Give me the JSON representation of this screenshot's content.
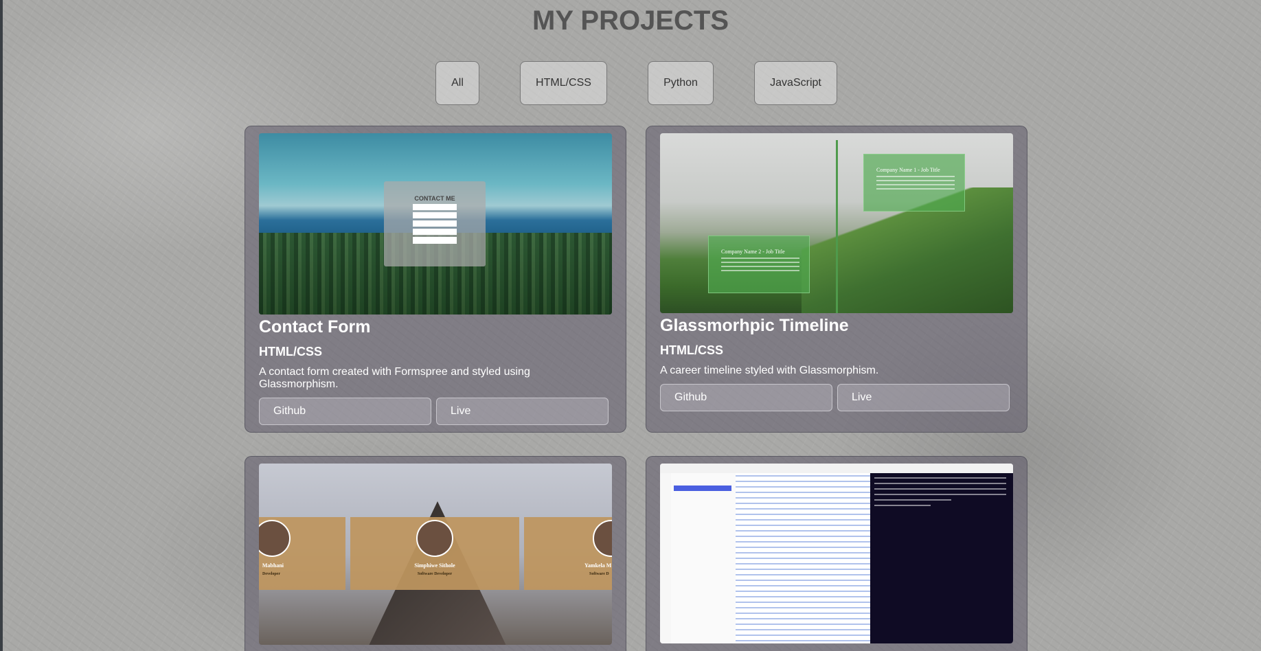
{
  "page": {
    "title": "MY PROJECTS"
  },
  "filters": [
    {
      "label": "All"
    },
    {
      "label": "HTML/CSS"
    },
    {
      "label": "Python"
    },
    {
      "label": "JavaScript"
    }
  ],
  "projects": [
    {
      "title": "Contact Form",
      "category": "HTML/CSS",
      "description": "A contact form created with Formspree and styled using Glassmorphism.",
      "github_label": "Github",
      "live_label": "Live",
      "thumbnail": {
        "form_title": "CONTACT ME"
      }
    },
    {
      "title": "Glassmorhpic Timeline",
      "category": "HTML/CSS",
      "description": "A career timeline styled with Glassmorphism.",
      "github_label": "Github",
      "live_label": "Live",
      "thumbnail": {
        "entry_top": "Company Name 1 - Job Title",
        "entry_bottom": "Company Name 2 - Job Title"
      }
    },
    {
      "thumbnail": {
        "people": [
          {
            "name": "Mabhani",
            "role": "Developer"
          },
          {
            "name": "Simphiwe Sithole",
            "role": "Software Developer"
          },
          {
            "name": "Yamkela M",
            "role": "Software D"
          }
        ]
      }
    },
    {
      "thumbnail": {}
    }
  ]
}
